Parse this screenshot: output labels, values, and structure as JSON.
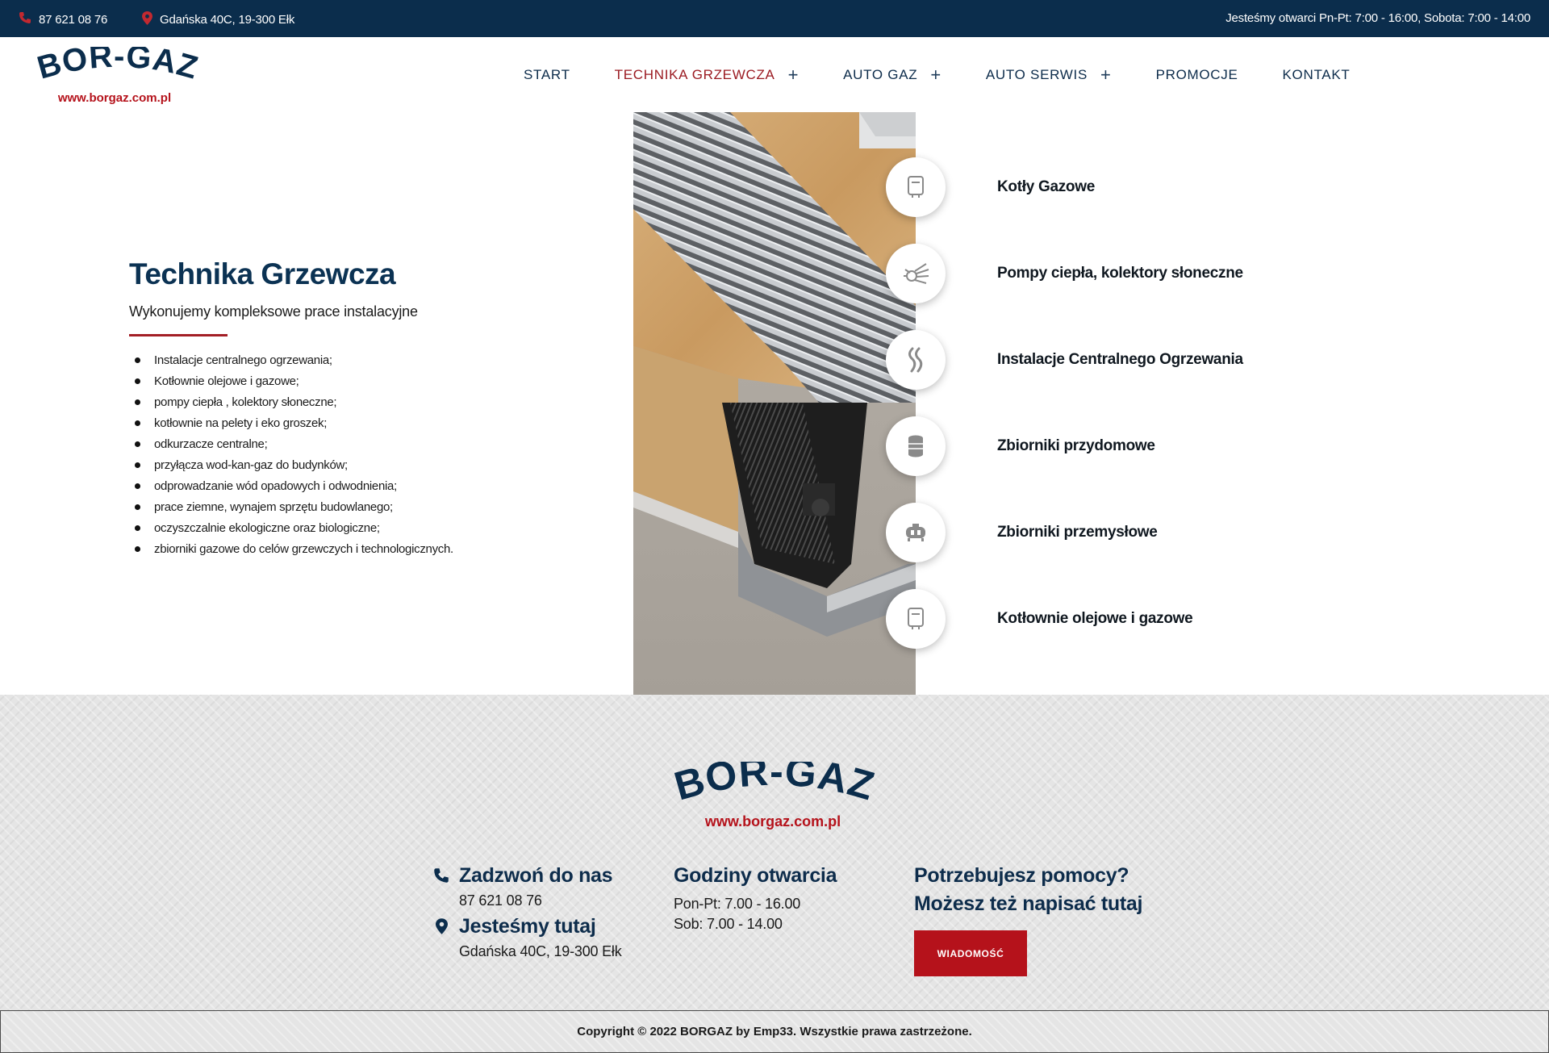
{
  "topbar": {
    "phone": "87 621 08 76",
    "address": "Gdańska 40C, 19-300 Ełk",
    "hours": "Jesteśmy otwarci Pn-Pt: 7:00 - 16:00, Sobota: 7:00 - 14:00"
  },
  "logo": {
    "name": "BOR-GAZ",
    "url": "www.borgaz.com.pl"
  },
  "nav": {
    "start": "START",
    "technika": "TECHNIKA GRZEWCZA",
    "autogaz": "AUTO GAZ",
    "autoserwis": "AUTO SERWIS",
    "promocje": "PROMOCJE",
    "kontakt": "KONTAKT",
    "plus": "+"
  },
  "hero": {
    "title": "Technika Grzewcza",
    "subtitle": "Wykonujemy kompleksowe prace instalacyjne",
    "items": [
      "Instalacje centralnego ogrzewania;",
      "Kotłownie olejowe i gazowe;",
      "pompy ciepła , kolektory słoneczne;",
      "kotłownie na pelety i eko groszek;",
      "odkurzacze centralne;",
      "przyłącza wod-kan-gaz do budynków;",
      "odprowadzanie wód opadowych i odwodnienia;",
      "prace ziemne, wynajem sprzętu budowlanego;",
      "oczyszczalnie ekologiczne oraz biologiczne;",
      "zbiorniki gazowe do celów grzewczych i technologicznych."
    ]
  },
  "services": [
    {
      "label": "Kotły Gazowe",
      "icon": "boiler-icon"
    },
    {
      "label": "Pompy ciepła, kolektory słoneczne",
      "icon": "heat-pump-icon"
    },
    {
      "label": "Instalacje Centralnego Ogrzewania",
      "icon": "heating-flame-icon"
    },
    {
      "label": "Zbiorniki przydomowe",
      "icon": "tank-icon"
    },
    {
      "label": "Zbiorniki przemysłowe",
      "icon": "industrial-tank-icon"
    },
    {
      "label": "Kotłownie olejowe i gazowe",
      "icon": "boiler-icon"
    }
  ],
  "footer": {
    "call_heading": "Zadzwoń do nas",
    "call_phone": "87 621 08 76",
    "location_heading": "Jesteśmy tutaj",
    "location_address": "Gdańska 40C, 19-300 Ełk",
    "hours_heading": "Godziny otwarcia",
    "hours_weekday": "Pon-Pt: 7.00 - 16.00",
    "hours_saturday": "Sob: 7.00 - 14.00",
    "help_heading_1": "Potrzebujesz pomocy?",
    "help_heading_2": "Możesz też napisać tutaj",
    "message_button": "WIADOMOŚĆ"
  },
  "copyright": "Copyright © 2022 BORGAZ by Emp33. Wszystkie prawa zastrzeżone.",
  "colors": {
    "navy": "#0b2d4c",
    "accent_red": "#b5121b",
    "active_nav": "#9b1b22"
  }
}
